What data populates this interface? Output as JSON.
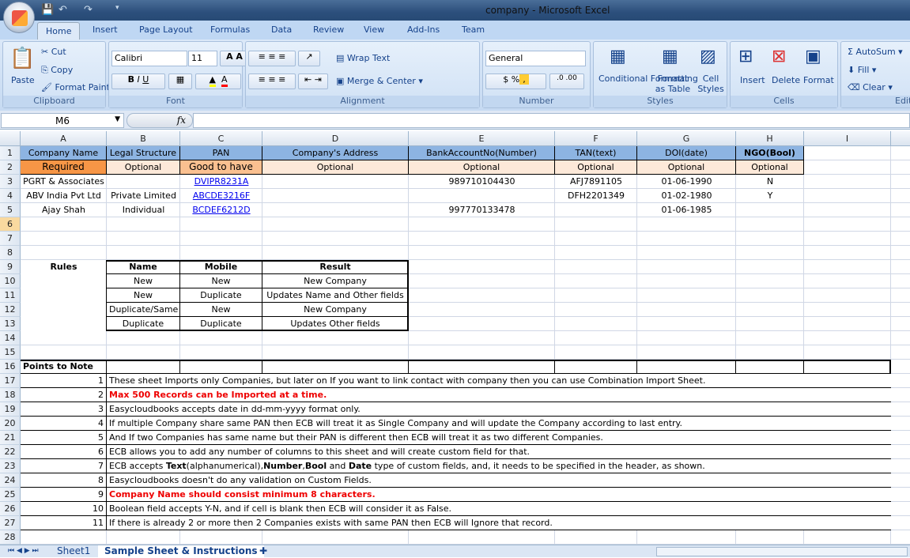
{
  "window": {
    "title": "company - Microsoft Excel"
  },
  "ribbon": {
    "tabs": [
      "Home",
      "Insert",
      "Page Layout",
      "Formulas",
      "Data",
      "Review",
      "View",
      "Add-Ins",
      "Team"
    ],
    "active_tab": "Home",
    "clipboard": {
      "label": "Clipboard",
      "paste": "Paste",
      "cut": "Cut",
      "copy": "Copy",
      "format_painter": "Format Painter"
    },
    "font": {
      "label": "Font",
      "name": "Calibri",
      "size": "11",
      "fill_color": "#ffff00",
      "font_color": "#ff0000"
    },
    "alignment": {
      "label": "Alignment",
      "wrap": "Wrap Text",
      "merge": "Merge & Center"
    },
    "number": {
      "label": "Number",
      "format": "General"
    },
    "styles": {
      "label": "Styles",
      "conditional": "Conditional Formatting",
      "as_table": "Format as Table",
      "cell_styles": "Cell Styles"
    },
    "cells": {
      "label": "Cells",
      "insert": "Insert",
      "delete": "Delete",
      "format": "Format"
    },
    "editing": {
      "label": "Edit",
      "autosum": "AutoSum",
      "fill": "Fill",
      "clear": "Clear"
    }
  },
  "formula_bar": {
    "name_box": "M6",
    "fx": "fx",
    "value": ""
  },
  "columns": [
    "A",
    "B",
    "C",
    "D",
    "E",
    "F",
    "G",
    "H",
    "I"
  ],
  "rows": [
    "1",
    "2",
    "3",
    "4",
    "5",
    "6",
    "7",
    "8",
    "9",
    "10",
    "11",
    "12",
    "13",
    "14",
    "15",
    "16",
    "17",
    "18",
    "19",
    "20",
    "21",
    "22",
    "23",
    "24",
    "25",
    "26",
    "27",
    "28"
  ],
  "cells": [
    {
      "ref": "A1",
      "v": "Company Name"
    },
    {
      "ref": "B1",
      "v": "Legal Structure"
    },
    {
      "ref": "C1",
      "v": "PAN"
    },
    {
      "ref": "D1",
      "v": "Company's Address"
    },
    {
      "ref": "E1",
      "v": "BankAccountNo(Number)"
    },
    {
      "ref": "F1",
      "v": "TAN(text)"
    },
    {
      "ref": "G1",
      "v": "DOI(date)"
    },
    {
      "ref": "H1",
      "v": "NGO(Bool)"
    },
    {
      "ref": "A2",
      "v": "Required"
    },
    {
      "ref": "B2",
      "v": "Optional"
    },
    {
      "ref": "C2",
      "v": "Good to have"
    },
    {
      "ref": "D2",
      "v": "Optional"
    },
    {
      "ref": "E2",
      "v": "Optional"
    },
    {
      "ref": "F2",
      "v": "Optional"
    },
    {
      "ref": "G2",
      "v": "Optional"
    },
    {
      "ref": "H2",
      "v": "Optional"
    },
    {
      "ref": "A3",
      "v": "PGRT & Associates"
    },
    {
      "ref": "C3",
      "v": "DVIPR8231A"
    },
    {
      "ref": "E3",
      "v": "989710104430"
    },
    {
      "ref": "F3",
      "v": "AFJ7891105"
    },
    {
      "ref": "G3",
      "v": "01-06-1990"
    },
    {
      "ref": "H3",
      "v": "N"
    },
    {
      "ref": "A4",
      "v": "ABV India Pvt Ltd"
    },
    {
      "ref": "B4",
      "v": "Private Limited"
    },
    {
      "ref": "C4",
      "v": "ABCDE3216F"
    },
    {
      "ref": "F4",
      "v": "DFH2201349"
    },
    {
      "ref": "G4",
      "v": "01-02-1980"
    },
    {
      "ref": "H4",
      "v": "Y"
    },
    {
      "ref": "A5",
      "v": "Ajay Shah"
    },
    {
      "ref": "B5",
      "v": "Individual"
    },
    {
      "ref": "C5",
      "v": "BCDEF6212D"
    },
    {
      "ref": "E5",
      "v": "997770133478"
    },
    {
      "ref": "G5",
      "v": "01-06-1985"
    },
    {
      "ref": "A9",
      "v": "Rules"
    },
    {
      "ref": "B9",
      "v": "Name"
    },
    {
      "ref": "C9",
      "v": "Mobile"
    },
    {
      "ref": "D9",
      "v": "Result"
    },
    {
      "ref": "B10",
      "v": "New"
    },
    {
      "ref": "C10",
      "v": "New"
    },
    {
      "ref": "D10",
      "v": "New Company"
    },
    {
      "ref": "B11",
      "v": "New"
    },
    {
      "ref": "C11",
      "v": "Duplicate"
    },
    {
      "ref": "D11",
      "v": "Updates Name and Other fields"
    },
    {
      "ref": "B12",
      "v": "Duplicate/Same"
    },
    {
      "ref": "C12",
      "v": "New"
    },
    {
      "ref": "D12",
      "v": "New Company"
    },
    {
      "ref": "B13",
      "v": "Duplicate"
    },
    {
      "ref": "C13",
      "v": "Duplicate"
    },
    {
      "ref": "D13",
      "v": "Updates Other fields"
    },
    {
      "ref": "A16",
      "v": "Points to Note"
    }
  ],
  "points": [
    {
      "n": "1",
      "text": "These sheet Imports only Companies, but later on If you want to link contact with company then you can use Combination Import Sheet."
    },
    {
      "n": "2",
      "text": "Max 500 Records can be Imported at a time.",
      "highlight": true
    },
    {
      "n": "3",
      "text": "Easycloudbooks accepts date in dd-mm-yyyy format only."
    },
    {
      "n": "4",
      "text": "If multiple Company share same PAN then ECB will treat it as Single Company and will update the Company according to last entry."
    },
    {
      "n": "5",
      "text": "And If two Companies has same name but their PAN is different then ECB will treat it as two different Companies."
    },
    {
      "n": "6",
      "text": "ECB allows you to add any number of columns to this sheet and will create custom field for that."
    },
    {
      "n": "7",
      "rich": [
        [
          "ECB accepts ",
          0
        ],
        [
          "Text",
          1
        ],
        [
          "(alphanumerical),",
          0
        ],
        [
          "Number",
          1
        ],
        [
          ",",
          0
        ],
        [
          "Bool",
          1
        ],
        [
          " and ",
          0
        ],
        [
          "Date",
          1
        ],
        [
          " type of custom fields, and, it needs to be specified in the header, as shown.",
          0
        ]
      ]
    },
    {
      "n": "8",
      "text": "Easycloudbooks doesn't do any validation on Custom Fields."
    },
    {
      "n": "9",
      "text": "Company Name should consist minimum 8 characters.",
      "highlight": true
    },
    {
      "n": "10",
      "text": "Boolean field accepts  Y-N, and if cell is blank then ECB will consider it as False."
    },
    {
      "n": "11",
      "text": "If there is already 2 or more then 2 Companies exists with same PAN  then ECB will Ignore that record."
    }
  ],
  "colors": {
    "header_blue": "#8db4e2",
    "required": "#f79646",
    "good_to_have": "#fac090",
    "optional": "#fde9d9",
    "warning_red": "#ee0000"
  },
  "sheets": {
    "tabs": [
      "Sheet1",
      "Sample Sheet & Instructions"
    ],
    "active": "Sample Sheet & Instructions"
  }
}
